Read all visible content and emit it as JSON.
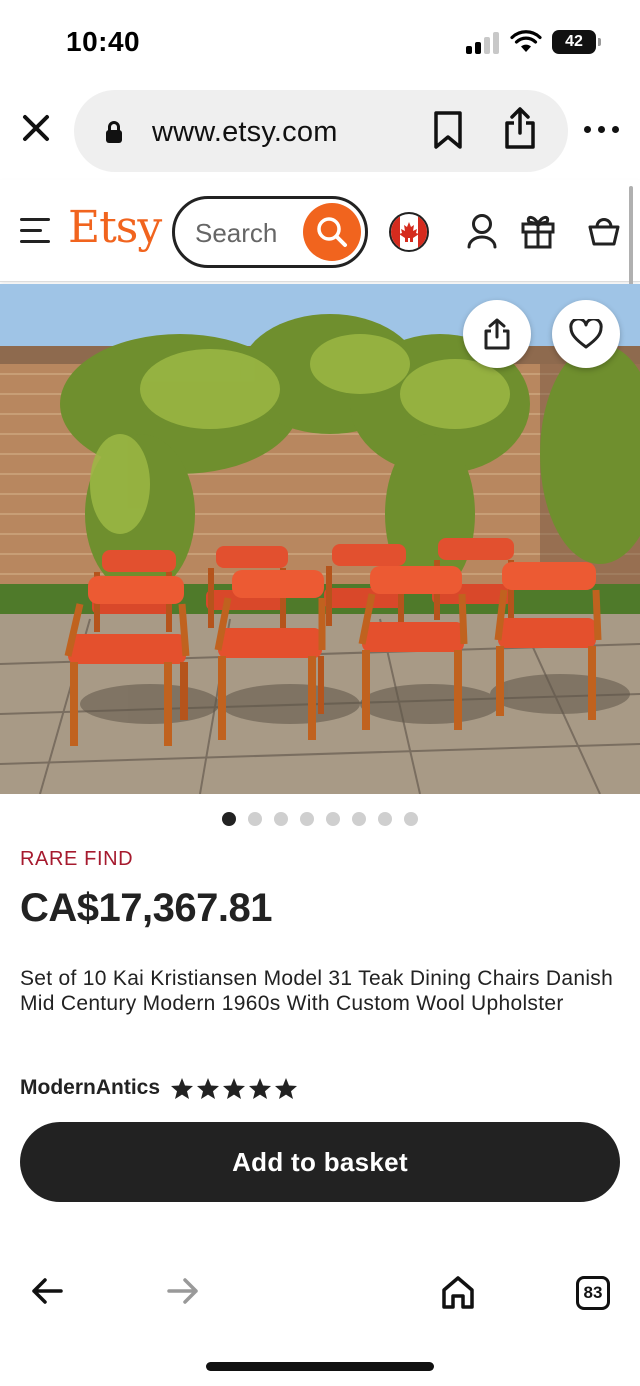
{
  "status_bar": {
    "time": "10:40",
    "battery": "42"
  },
  "browser": {
    "url": "www.etsy.com",
    "tabs_count": "83"
  },
  "header": {
    "logo": "Etsy",
    "search_placeholder": "Search"
  },
  "product": {
    "image_alt_icon": "chairs-photo",
    "carousel_total": 8,
    "carousel_active": 1,
    "badge": "RARE FIND",
    "price": "CA$17,367.81",
    "title": "Set of 10 Kai Kristiansen Model 31 Teak Dining Chairs Danish Mid Century Modern 1960s With Custom Wool Upholster",
    "shop_name": "ModernAntics",
    "rating_stars": 5,
    "add_to_basket": "Add to basket"
  },
  "colors": {
    "brand_orange": "#f1641e",
    "badge_red": "#a61a2e",
    "button_dark": "#222222"
  }
}
